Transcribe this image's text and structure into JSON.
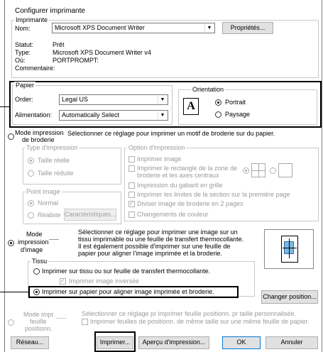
{
  "window": {
    "title": "Configurer imprimante"
  },
  "printer": {
    "group_label": "Imprimante",
    "name_label": "Nom:",
    "name_value": "Microsoft XPS Document Writer",
    "properties_button": "Propriétés...",
    "status_label": "Statut:",
    "status_value": "Prêt",
    "type_label": "Type:",
    "type_value": "Microsoft XPS Document Writer v4",
    "where_label": "Où:",
    "where_value": "PORTPROMPT:",
    "comment_label": "Commentaire:"
  },
  "paper": {
    "group_label": "Papier",
    "order_label": "Order:",
    "order_value": "Legal US",
    "feed_label": "Alimentation:",
    "feed_value": "Automatically Select"
  },
  "orientation": {
    "group_label": "Orientation",
    "portrait": "Portrait",
    "landscape": "Paysage",
    "icon_letter": "A"
  },
  "embroidery_mode": {
    "label_l1": "Mode impression",
    "label_l2": "de broderie",
    "description": "Sélectionner ce réglage pour imprimer un motif de broderie sur du papier.",
    "print_type_label": "Type d'impression",
    "actual_size": "Taille réelle",
    "reduced_size": "Taille réduite",
    "options_label": "Option d'impression",
    "opt_print_image": "Imprimer image",
    "opt_rect_l1": "Imprimer le rectangle de la zone de",
    "opt_rect_l2": "broderie et les axes centraux",
    "opt_grid": "Impression du gabarit en grille",
    "opt_section_limits": "Imprimer les limites de la section sur la première page",
    "opt_split": "Diviser image de broderie en 2 pages",
    "opt_color_changes": "Changements de couleur",
    "point_image_label": "Point image",
    "normal": "Normal",
    "realistic": "Réaliste",
    "characteristics_button": "Caractéristiques..."
  },
  "image_mode": {
    "label_l1": "Mode",
    "label_l2": "impression",
    "label_l3": "d'image",
    "desc_l1": "Sélectionner ce réglage pour imprimer une image sur un",
    "desc_l2": "tissu imprimable ou une feuille de transfert thermocollante.",
    "desc_l3": "Il est également possible d'imprimer sur une feuille de",
    "desc_l4": "papier pour aligner l'image imprimée et la broderie.",
    "fabric_label": "Tissu",
    "fabric_option": "Imprimer sur tissu ou sur feuille de transfert thermocollante.",
    "inverted": "Imprimer image inversée",
    "paper_option": "Imprimer sur papier pour aligner image imprimée et broderie.",
    "change_position_button": "Changer position..."
  },
  "position_sheet_mode": {
    "label_l1": "Mode impr.",
    "label_l2": "feuille",
    "label_l3": "positionn.",
    "desc": "Sélectionner ce réglage pr imprimer feuille positionn. pr taille personnalisée.",
    "option": "Imprimer feuilles de positionn. de même taille sur une même feuille de papier."
  },
  "footer": {
    "network_button": "Réseau...",
    "print_button": "Imprimer...",
    "preview_button": "Aperçu d'impression...",
    "ok_button": "OK",
    "cancel_button": "Annuler"
  }
}
